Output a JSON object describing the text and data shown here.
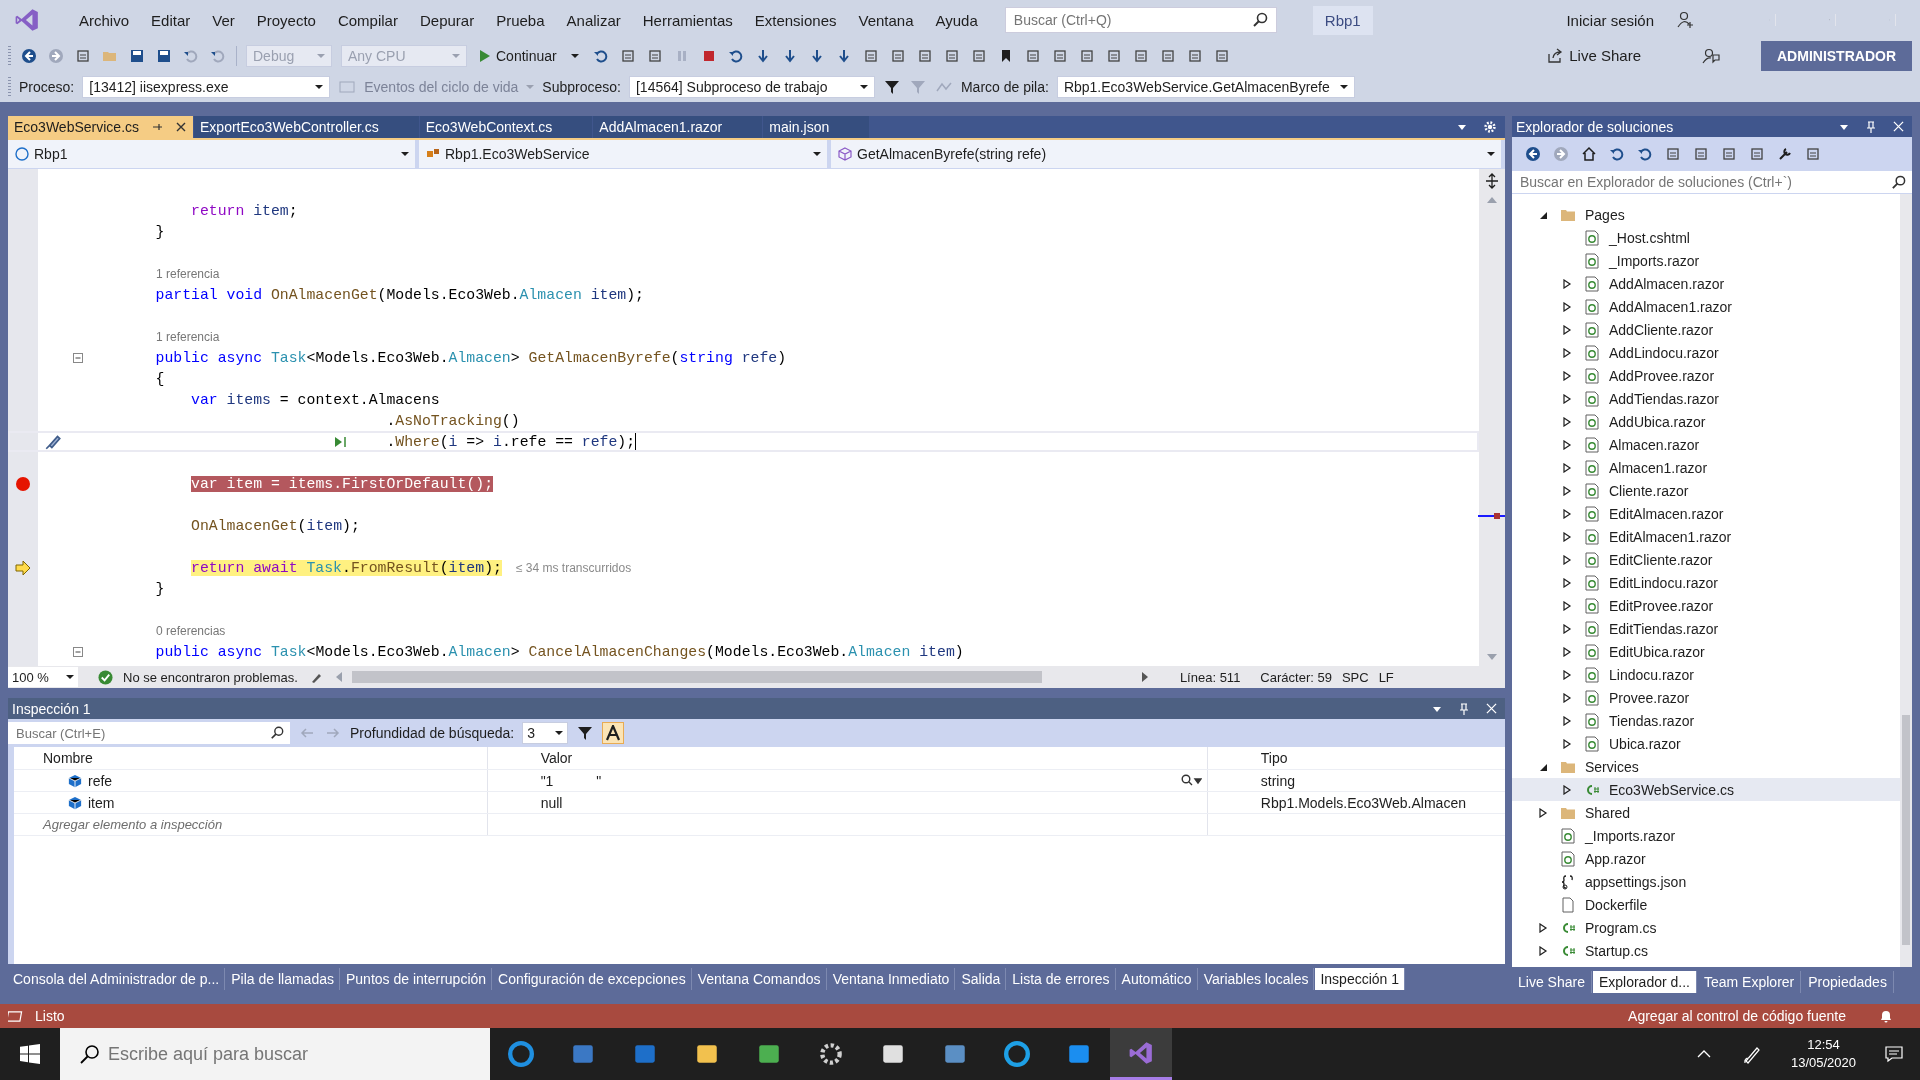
{
  "menu_bar": {
    "items": [
      "Archivo",
      "Editar",
      "Ver",
      "Proyecto",
      "Compilar",
      "Depurar",
      "Prueba",
      "Analizar",
      "Herramientas",
      "Extensiones",
      "Ventana",
      "Ayuda"
    ],
    "search": {
      "placeholder": "Buscar (Ctrl+Q)"
    },
    "solution_name": "Rbp1",
    "sign_in": "Iniciar sesión"
  },
  "toolbar": {
    "configuration": {
      "value": "Debug",
      "disabled": true
    },
    "platform": {
      "value": "Any CPU",
      "disabled": true
    },
    "continue": "Continuar",
    "live_share": "Live Share",
    "admin_badge": "ADMINISTRADOR"
  },
  "debug_location": {
    "process_label": "Proceso:",
    "process": "[13412] iisexpress.exe",
    "lifecycle": "Eventos del ciclo de vida",
    "thread_label": "Subproceso:",
    "thread": "[14564] Subproceso de trabajo",
    "stack_label": "Marco de pila:",
    "stack_frame": "Rbp1.Eco3WebService.GetAlmacenByrefe"
  },
  "document_tabs": [
    {
      "label": "Eco3WebService.cs",
      "selected": true
    },
    {
      "label": "ExportEco3WebController.cs",
      "selected": false
    },
    {
      "label": "Eco3WebContext.cs",
      "selected": false
    },
    {
      "label": "AddAlmacen1.razor",
      "selected": false
    },
    {
      "label": "main.json",
      "selected": false
    }
  ],
  "navigation_bar": {
    "project": "Rbp1",
    "type": "Rbp1.Eco3WebService",
    "member": "GetAlmacenByrefe(string refe)"
  },
  "code_lines": [
    {
      "kind": "blank"
    },
    {
      "kind": "code",
      "tokens": [
        {
          "kind": "ctrl",
          "text": "        return "
        },
        {
          "kind": "local",
          "text": "item"
        },
        {
          "kind": "plain",
          "text": ";"
        }
      ]
    },
    {
      "kind": "code",
      "tokens": [
        {
          "kind": "plain",
          "text": "    }"
        }
      ]
    },
    {
      "kind": "blank"
    },
    {
      "kind": "codelens",
      "text": "1 referencia"
    },
    {
      "kind": "code",
      "tokens": [
        {
          "kind": "kw",
          "text": "    partial void "
        },
        {
          "kind": "method",
          "text": "OnAlmacenGet"
        },
        {
          "kind": "plain",
          "text": "(Models.Eco3Web."
        },
        {
          "kind": "type",
          "text": "Almacen"
        },
        {
          "kind": "local",
          "text": " item"
        },
        {
          "kind": "plain",
          "text": ");"
        }
      ]
    },
    {
      "kind": "blank"
    },
    {
      "kind": "codelens",
      "text": "1 referencia"
    },
    {
      "kind": "code",
      "foldable": true,
      "tokens": [
        {
          "kind": "kw",
          "text": "    public async "
        },
        {
          "kind": "type",
          "text": "Task"
        },
        {
          "kind": "plain",
          "text": "<Models.Eco3Web."
        },
        {
          "kind": "type",
          "text": "Almacen"
        },
        {
          "kind": "plain",
          "text": "> "
        },
        {
          "kind": "method",
          "text": "GetAlmacenByrefe"
        },
        {
          "kind": "plain",
          "text": "("
        },
        {
          "kind": "kw",
          "text": "string "
        },
        {
          "kind": "local",
          "text": "refe"
        },
        {
          "kind": "plain",
          "text": ")"
        }
      ]
    },
    {
      "kind": "code",
      "tokens": [
        {
          "kind": "plain",
          "text": "    {"
        }
      ]
    },
    {
      "kind": "code",
      "tokens": [
        {
          "kind": "kw",
          "text": "        var "
        },
        {
          "kind": "local",
          "text": "items"
        },
        {
          "kind": "plain",
          "text": " = context.Almacens"
        }
      ]
    },
    {
      "kind": "code",
      "tokens": [
        {
          "kind": "plain",
          "text": "                              ."
        },
        {
          "kind": "method",
          "text": "AsNoTracking"
        },
        {
          "kind": "plain",
          "text": "()"
        }
      ]
    },
    {
      "kind": "code",
      "caret": true,
      "tokens": [
        {
          "kind": "plain",
          "text": "                              ."
        },
        {
          "kind": "method",
          "text": "Where"
        },
        {
          "kind": "plain",
          "text": "("
        },
        {
          "kind": "local",
          "text": "i"
        },
        {
          "kind": "plain",
          "text": " => "
        },
        {
          "kind": "local",
          "text": "i"
        },
        {
          "kind": "plain",
          "text": ".refe == "
        },
        {
          "kind": "local",
          "text": "refe"
        },
        {
          "kind": "plain",
          "text": ");"
        }
      ]
    },
    {
      "kind": "blank"
    },
    {
      "kind": "code",
      "breakpoint": true,
      "tokens": [
        {
          "kind": "kw",
          "text": "        var "
        },
        {
          "kind": "local",
          "text": "item"
        },
        {
          "kind": "plain",
          "text": " = "
        },
        {
          "kind": "local",
          "text": "items"
        },
        {
          "kind": "plain",
          "text": "."
        },
        {
          "kind": "method",
          "text": "FirstOrDefault"
        },
        {
          "kind": "plain",
          "text": "();"
        }
      ]
    },
    {
      "kind": "blank"
    },
    {
      "kind": "code",
      "tokens": [
        {
          "kind": "method",
          "text": "        OnAlmacenGet"
        },
        {
          "kind": "plain",
          "text": "("
        },
        {
          "kind": "local",
          "text": "item"
        },
        {
          "kind": "plain",
          "text": ");"
        }
      ]
    },
    {
      "kind": "blank"
    },
    {
      "kind": "code",
      "current": true,
      "hint": "≤ 34 ms transcurridos",
      "tokens": [
        {
          "kind": "ctrl",
          "text": "        return await "
        },
        {
          "kind": "type",
          "text": "Task"
        },
        {
          "kind": "plain",
          "text": "."
        },
        {
          "kind": "method",
          "text": "FromResult"
        },
        {
          "kind": "plain",
          "text": "("
        },
        {
          "kind": "local",
          "text": "item"
        },
        {
          "kind": "plain",
          "text": ");"
        }
      ]
    },
    {
      "kind": "code",
      "tokens": [
        {
          "kind": "plain",
          "text": "    }"
        }
      ]
    },
    {
      "kind": "blank"
    },
    {
      "kind": "codelens",
      "text": "0 referencias"
    },
    {
      "kind": "code",
      "foldable": true,
      "tokens": [
        {
          "kind": "kw",
          "text": "    public async "
        },
        {
          "kind": "type",
          "text": "Task"
        },
        {
          "kind": "plain",
          "text": "<Models.Eco3Web."
        },
        {
          "kind": "type",
          "text": "Almacen"
        },
        {
          "kind": "plain",
          "text": "> "
        },
        {
          "kind": "method",
          "text": "CancelAlmacenChanges"
        },
        {
          "kind": "plain",
          "text": "(Models.Eco3Web."
        },
        {
          "kind": "type",
          "text": "Almacen"
        },
        {
          "kind": "local",
          "text": " item"
        },
        {
          "kind": "plain",
          "text": ")"
        }
      ]
    }
  ],
  "editor_status": {
    "zoom": "100 %",
    "issues": "No se encontraron problemas.",
    "line": "Línea: 511",
    "column": "Carácter: 59",
    "whitespace": "SPC",
    "line_ending": "LF"
  },
  "watch_panel": {
    "title": "Inspección 1",
    "search": {
      "placeholder": "Buscar (Ctrl+E)"
    },
    "depth_label": "Profundidad de búsqueda:",
    "depth": "3",
    "columns": [
      "Nombre",
      "Valor",
      "Tipo"
    ],
    "rows": [
      {
        "name": "refe",
        "value": "\"1           \"",
        "type": "string",
        "viewer": true
      },
      {
        "name": "item",
        "value": "null",
        "type": "Rbp1.Models.Eco3Web.Almacen",
        "viewer": false
      }
    ],
    "add_placeholder": "Agregar elemento a inspección"
  },
  "bottom_tabs": [
    {
      "label": "Consola del Administrador de p...",
      "selected": false
    },
    {
      "label": "Pila de llamadas",
      "selected": false
    },
    {
      "label": "Puntos de interrupción",
      "selected": false
    },
    {
      "label": "Configuración de excepciones",
      "selected": false
    },
    {
      "label": "Ventana Comandos",
      "selected": false
    },
    {
      "label": "Ventana Inmediato",
      "selected": false
    },
    {
      "label": "Salida",
      "selected": false
    },
    {
      "label": "Lista de errores",
      "selected": false
    },
    {
      "label": "Automático",
      "selected": false
    },
    {
      "label": "Variables locales",
      "selected": false
    },
    {
      "label": "Inspección 1",
      "selected": true
    }
  ],
  "solution_explorer": {
    "title": "Explorador de soluciones",
    "search": {
      "placeholder": "Buscar en Explorador de soluciones (Ctrl+`)"
    },
    "tree": [
      {
        "label": "Pages",
        "kind": "folder",
        "expandable": true,
        "expanded": true,
        "selected": false,
        "children": [
          {
            "label": "_Host.cshtml",
            "kind": "razor",
            "expandable": false,
            "selected": false
          },
          {
            "label": "_Imports.razor",
            "kind": "razor",
            "expandable": false,
            "selected": false
          },
          {
            "label": "AddAlmacen.razor",
            "kind": "razor",
            "expandable": true,
            "expanded": false,
            "selected": false
          },
          {
            "label": "AddAlmacen1.razor",
            "kind": "razor",
            "expandable": true,
            "expanded": false,
            "selected": false
          },
          {
            "label": "AddCliente.razor",
            "kind": "razor",
            "expandable": true,
            "expanded": false,
            "selected": false
          },
          {
            "label": "AddLindocu.razor",
            "kind": "razor",
            "expandable": true,
            "expanded": false,
            "selected": false
          },
          {
            "label": "AddProvee.razor",
            "kind": "razor",
            "expandable": true,
            "expanded": false,
            "selected": false
          },
          {
            "label": "AddTiendas.razor",
            "kind": "razor",
            "expandable": true,
            "expanded": false,
            "selected": false
          },
          {
            "label": "AddUbica.razor",
            "kind": "razor",
            "expandable": true,
            "expanded": false,
            "selected": false
          },
          {
            "label": "Almacen.razor",
            "kind": "razor",
            "expandable": true,
            "expanded": false,
            "selected": false
          },
          {
            "label": "Almacen1.razor",
            "kind": "razor",
            "expandable": true,
            "expanded": false,
            "selected": false
          },
          {
            "label": "Cliente.razor",
            "kind": "razor",
            "expandable": true,
            "expanded": false,
            "selected": false
          },
          {
            "label": "EditAlmacen.razor",
            "kind": "razor",
            "expandable": true,
            "expanded": false,
            "selected": false
          },
          {
            "label": "EditAlmacen1.razor",
            "kind": "razor",
            "expandable": true,
            "expanded": false,
            "selected": false
          },
          {
            "label": "EditCliente.razor",
            "kind": "razor",
            "expandable": true,
            "expanded": false,
            "selected": false
          },
          {
            "label": "EditLindocu.razor",
            "kind": "razor",
            "expandable": true,
            "expanded": false,
            "selected": false
          },
          {
            "label": "EditProvee.razor",
            "kind": "razor",
            "expandable": true,
            "expanded": false,
            "selected": false
          },
          {
            "label": "EditTiendas.razor",
            "kind": "razor",
            "expandable": true,
            "expanded": false,
            "selected": false
          },
          {
            "label": "EditUbica.razor",
            "kind": "razor",
            "expandable": true,
            "expanded": false,
            "selected": false
          },
          {
            "label": "Lindocu.razor",
            "kind": "razor",
            "expandable": true,
            "expanded": false,
            "selected": false
          },
          {
            "label": "Provee.razor",
            "kind": "razor",
            "expandable": true,
            "expanded": false,
            "selected": false
          },
          {
            "label": "Tiendas.razor",
            "kind": "razor",
            "expandable": true,
            "expanded": false,
            "selected": false
          },
          {
            "label": "Ubica.razor",
            "kind": "razor",
            "expandable": true,
            "expanded": false,
            "selected": false
          }
        ]
      },
      {
        "label": "Services",
        "kind": "folder",
        "expandable": true,
        "expanded": true,
        "selected": false,
        "children": [
          {
            "label": "Eco3WebService.cs",
            "kind": "csharp",
            "expandable": true,
            "expanded": false,
            "selected": true
          }
        ]
      },
      {
        "label": "Shared",
        "kind": "folder",
        "expandable": true,
        "expanded": false,
        "selected": false
      },
      {
        "label": "_Imports.razor",
        "kind": "razor",
        "expandable": false,
        "selected": false
      },
      {
        "label": "App.razor",
        "kind": "razor",
        "expandable": false,
        "selected": false
      },
      {
        "label": "appsettings.json",
        "kind": "json",
        "expandable": false,
        "selected": false
      },
      {
        "label": "Dockerfile",
        "kind": "file",
        "expandable": false,
        "selected": false
      },
      {
        "label": "Program.cs",
        "kind": "csharp",
        "expandable": true,
        "expanded": false,
        "selected": false
      },
      {
        "label": "Startup.cs",
        "kind": "csharp",
        "expandable": true,
        "expanded": false,
        "selected": false
      }
    ],
    "tabs": [
      {
        "label": "Live Share",
        "selected": false
      },
      {
        "label": "Explorador d...",
        "selected": true
      },
      {
        "label": "Team Explorer",
        "selected": false
      },
      {
        "label": "Propiedades",
        "selected": false
      }
    ]
  },
  "status_bar": {
    "text": "Listo",
    "source_control": "Agregar al control de código fuente"
  },
  "taskbar": {
    "search": {
      "placeholder": "Escribe aquí para buscar"
    },
    "time": "12:54",
    "date": "13/05/2020"
  }
}
